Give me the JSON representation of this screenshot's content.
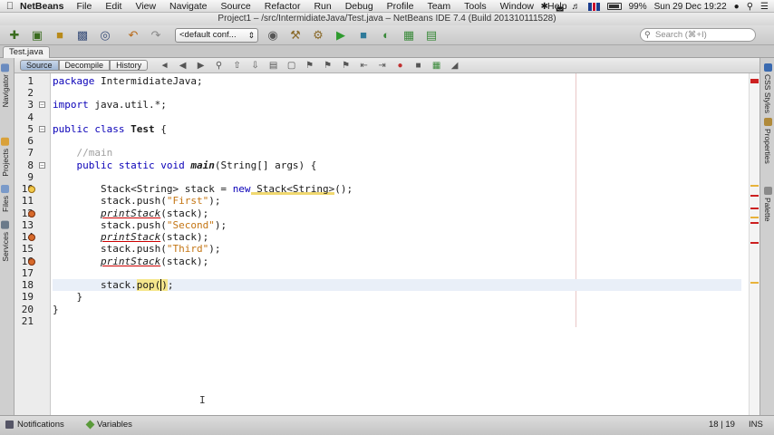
{
  "menubar": {
    "app_name": "NetBeans",
    "items": [
      "File",
      "Edit",
      "View",
      "Navigate",
      "Source",
      "Refactor",
      "Run",
      "Debug",
      "Profile",
      "Team",
      "Tools",
      "Window",
      "Help"
    ],
    "battery": "99%",
    "clock": "Sun 29 Dec  19:22"
  },
  "window": {
    "title": "Project1 – /src/IntermidiateJava/Test.java – NetBeans IDE 7.4 (Build 201310111528)"
  },
  "toolbar": {
    "config_value": "<default conf...",
    "search_placeholder": "Search (⌘+I)"
  },
  "editor_tab": {
    "label": "Test.java"
  },
  "subtoolbar": {
    "source_label": "Source",
    "decompile_label": "Decompile",
    "history_label": "History"
  },
  "left_strip": {
    "navigator": "Navigator",
    "projects": "Projects",
    "files": "Files",
    "services": "Services"
  },
  "right_strip": {
    "css_styles": "CSS Styles",
    "properties": "Properties",
    "palette": "Palette"
  },
  "code": {
    "l1_pkg_kw": "package",
    "l1_rest": " IntermidiateJava;",
    "l3_kw": "import",
    "l3_rest": " java.util.*;",
    "l5_kw": "public class",
    "l5_name": "Test",
    "l5_rest": " {",
    "l7_comment": "//main",
    "l8_kw": "public static void",
    "l8_name": "main",
    "l8_rest": "(String[] args) {",
    "l10_a": "Stack<String> stack = ",
    "l10_kw": "new",
    "l10_b": " Stack<String>",
    "l10_c": "();",
    "l11_a": "stack.push(",
    "l11_str": "\"First\"",
    "l11_b": ");",
    "l12_fn": "printStack",
    "l12_rest": "(stack);",
    "l13_a": "stack.push(",
    "l13_str": "\"Second\"",
    "l13_b": ");",
    "l14_fn": "printStack",
    "l14_rest": "(stack);",
    "l15_a": "stack.push(",
    "l15_str": "\"Third\"",
    "l15_b": ");",
    "l16_fn": "printStack",
    "l16_rest": "(stack);",
    "l18_a": "stack.",
    "l18_fn": "pop",
    "l18_open": "(",
    "l18_close": ")",
    "l18_b": ";",
    "l19": "}",
    "l20": "}"
  },
  "line_numbers": [
    "1",
    "2",
    "3",
    "4",
    "5",
    "6",
    "7",
    "8",
    "9",
    "10",
    "11",
    "12",
    "13",
    "14",
    "15",
    "16",
    "17",
    "18",
    "19",
    "20",
    "21"
  ],
  "statusbar": {
    "notifications": "Notifications",
    "variables": "Variables",
    "position": "18 | 19",
    "mode": "INS"
  }
}
